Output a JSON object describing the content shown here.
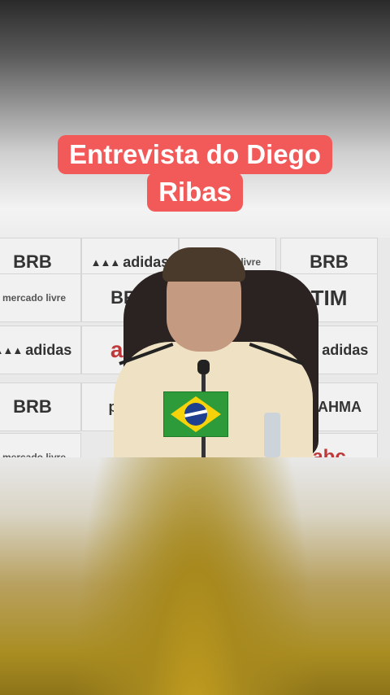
{
  "caption": {
    "line1": "Entrevista do Diego",
    "line2": "Ribas"
  },
  "video": {
    "sponsors": {
      "brb": "BRB",
      "adidas": "adidas",
      "mercado": "mercado livre",
      "tim": "TIM",
      "abc": "abc",
      "pixbet": "pixbet",
      "brahma": "BRAHMA"
    }
  },
  "colors": {
    "caption_bg": "#f25a5a",
    "caption_text": "#ffffff"
  },
  "icons": {
    "flag": "brazil-flag-icon"
  }
}
